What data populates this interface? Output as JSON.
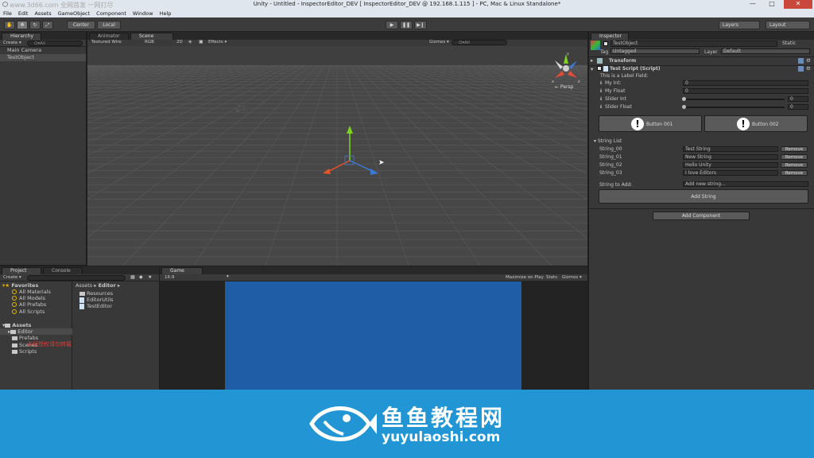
{
  "window": {
    "title": "Unity - Untitled - InspectorEditor_DEV [ InspectorEditor_DEV @ 192.168.1.115 ] - PC, Mac & Linux Standalone*",
    "watermark": "www.3d66.com 全网首发 一网打尽",
    "minimize": "—",
    "maximize": "□",
    "close": "✕"
  },
  "menu": [
    "File",
    "Edit",
    "Assets",
    "GameObject",
    "Component",
    "Window",
    "Help"
  ],
  "toolbar": {
    "center": "Center",
    "local": "Local",
    "layers": "Layers",
    "layout": "Layout"
  },
  "hierarchy": {
    "tab": "Hierarchy",
    "create": "Create ▾",
    "search": "Q▾All",
    "items": [
      "Main Camera",
      "TestObject"
    ]
  },
  "scene": {
    "tabs": [
      "Animator",
      "Scene"
    ],
    "shading": "Textured Wire",
    "rgb": "RGB",
    "two_d": "2D",
    "effects": "Effects ▾",
    "gizmos": "Gizmos ▾",
    "search": "Q▾All",
    "persp": "← Persp",
    "gizmo_axes": [
      "y",
      "x",
      "z"
    ]
  },
  "inspector": {
    "tab": "Inspector",
    "object_name": "TestObject",
    "static": "Static",
    "tag_label": "Tag",
    "tag_value": "Untagged",
    "layer_label": "Layer",
    "layer_value": "Default",
    "transform": "Transform",
    "script": "Test Script (Script)",
    "label_field": "This is a Label Field:",
    "fields": [
      {
        "label": "My Int:",
        "value": "0"
      },
      {
        "label": "My Float",
        "value": "0"
      }
    ],
    "sliders": [
      {
        "label": "Slider Int",
        "value": "0"
      },
      {
        "label": "Slider Float",
        "value": "0"
      }
    ],
    "button1": "Button 001",
    "button2": "Button 002",
    "string_list_label": "String List",
    "strings": [
      {
        "key": "String_00",
        "value": "Test String"
      },
      {
        "key": "String_01",
        "value": "New String"
      },
      {
        "key": "String_02",
        "value": "Hello Unity"
      },
      {
        "key": "String_03",
        "value": "I love Editors"
      }
    ],
    "remove": "Remove",
    "string_to_add_label": "String to Add:",
    "string_to_add_value": "Add new string...",
    "add_string": "Add String",
    "add_component": "Add Component"
  },
  "project": {
    "tabs": [
      "Project",
      "Console"
    ],
    "create": "Create ▾",
    "favorites": "Favorites",
    "favorite_items": [
      "All Materials",
      "All Models",
      "All Prefabs",
      "All Scripts"
    ],
    "assets": "Assets",
    "asset_items": [
      "Editor",
      "Prefabs",
      "Scenes",
      "Scripts"
    ],
    "overlay": "未经授权请勿转载",
    "breadcrumb_assets": "Assets ▸",
    "breadcrumb_editor": "Editor ▸",
    "files": [
      {
        "name": "Resources",
        "type": "folder"
      },
      {
        "name": "EditorUtils",
        "type": "file"
      },
      {
        "name": "TestEditor",
        "type": "file"
      }
    ]
  },
  "game": {
    "tab": "Game",
    "aspect": "16:9",
    "maximize_on_play": "Maximize on Play",
    "stats": "Stats",
    "gizmos": "Gizmos ▾"
  },
  "banner": {
    "title": "鱼鱼教程网",
    "url": "yuyulaoshi.com"
  },
  "colors": {
    "banner_bg": "#2296d5",
    "game_view": "#1f5da6",
    "scene_bg": "#474747",
    "selection": "#4a4a4a"
  }
}
